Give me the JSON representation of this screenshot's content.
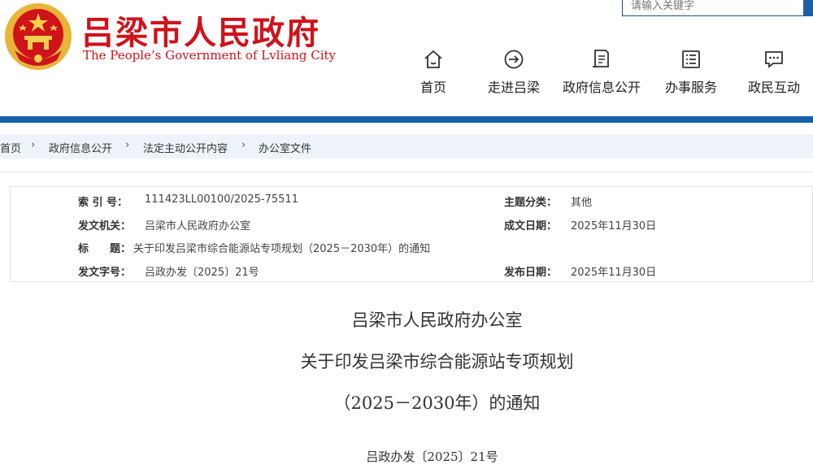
{
  "header": {
    "title_cn": "吕梁市人民政府",
    "title_en": "The People’s Government of Lvliang City",
    "search": {
      "placeholder": "请输入关键字"
    },
    "nav": [
      {
        "label": "首页",
        "icon": "home-icon"
      },
      {
        "label": "走进吕梁",
        "icon": "arrow-circle-icon"
      },
      {
        "label": "政府信息公开",
        "icon": "document-icon"
      },
      {
        "label": "办事服务",
        "icon": "list-icon"
      },
      {
        "label": "政民互动",
        "icon": "chat-icon"
      }
    ]
  },
  "breadcrumb": [
    "首页",
    "政府信息公开",
    "法定主动公开内容",
    "办公室文件"
  ],
  "meta": {
    "index_label": "索 引 号：",
    "index_value": "111423LL00100/2025-75511",
    "category_label": "主题分类：",
    "category_value": "其他",
    "issuer_label": "发文机关：",
    "issuer_value": "吕梁市人民政府办公室",
    "created_label": "成文日期：",
    "created_value": "2025年11月30日",
    "title_label": "标　　题：",
    "title_value": "关于印发吕梁市综合能源站专项规划（2025－2030年）的通知",
    "docno_label": "发文字号：",
    "docno_value": "吕政办发〔2025〕21号",
    "published_label": "发布日期：",
    "published_value": "2025年11月30日"
  },
  "document": {
    "title_line1": "吕梁市人民政府办公室",
    "title_line2": "关于印发吕梁市综合能源站专项规划",
    "title_line3": "（2025－2030年）的通知",
    "number": "吕政办发〔2025〕21号"
  },
  "colors": {
    "brand_red": "#d0121b",
    "brand_blue": "#1b5fa8",
    "breadcrumb_bg": "#eef3f9"
  }
}
